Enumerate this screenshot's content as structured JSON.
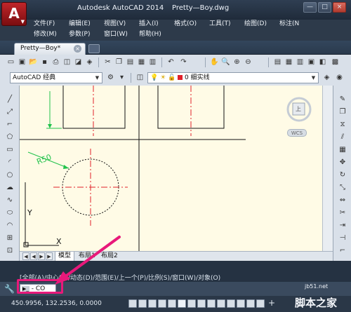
{
  "window": {
    "app_title": "Autodesk AutoCAD 2014",
    "file_title": "Pretty—Boy.dwg",
    "app_button_glyph": "A",
    "controls": [
      "—",
      "□",
      "×"
    ]
  },
  "menu": {
    "row1": [
      "文件(F)",
      "编辑(E)",
      "视图(V)",
      "插入(I)",
      "格式(O)",
      "工具(T)",
      "绘图(D)",
      "标注(N"
    ],
    "row2": [
      "修改(M)",
      "参数(P)",
      "窗口(W)",
      "帮助(H)"
    ]
  },
  "tabs": {
    "doc_tab": "Pretty—Boy*",
    "close_glyph": "×"
  },
  "toolbar": {
    "workspace": "AutoCAD 经典",
    "layer": "0",
    "linetype": "细实线"
  },
  "viewcube": {
    "top_label": "上",
    "wcs_label": "WCS"
  },
  "drawing": {
    "dimension_label": "R50",
    "ucs_x": "X",
    "ucs_y": "Y"
  },
  "layout_tabs": [
    "模型",
    "布局1",
    "布局2"
  ],
  "command": {
    "history": "[全部(A)/中心(C)/动态(D)/范围(E)/上一个(P)/比例(S)/窗口(W)/对象(O)",
    "input_value": "- CO",
    "prompt_glyph": "▶_"
  },
  "status": {
    "coordinates": "450.9956, 132.2536, 0.0000"
  },
  "watermark": {
    "url": "jb51.net",
    "text": "脚本之家"
  },
  "colors": {
    "accent_red": "#c0262a",
    "highlight": "#e8197a",
    "center_line": "#e0202a",
    "dimension_green": "#21c24b",
    "canvas": "#fffbe6"
  }
}
